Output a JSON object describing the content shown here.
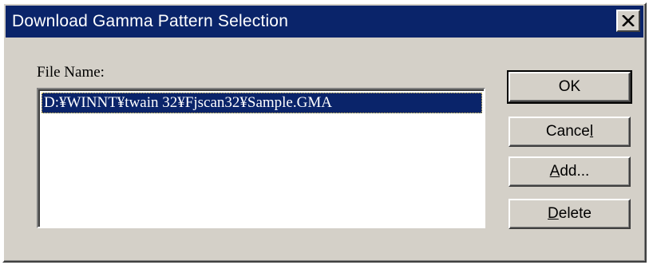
{
  "dialog": {
    "title": "Download Gamma Pattern Selection",
    "close_icon": "close-icon"
  },
  "file_list": {
    "label": "File Name:",
    "items": [
      "D:¥WINNT¥twain 32¥Fjscan32¥Sample.GMA"
    ],
    "selected_index": 0
  },
  "buttons": {
    "ok": "OK",
    "cancel_pre": "Cance",
    "cancel_accel": "l",
    "add_accel": "A",
    "add_post": "dd...",
    "delete_accel": "D",
    "delete_post": "elete"
  },
  "colors": {
    "face": "#d4d0c8",
    "titlebar": "#0a246a",
    "selection": "#0a246a"
  }
}
